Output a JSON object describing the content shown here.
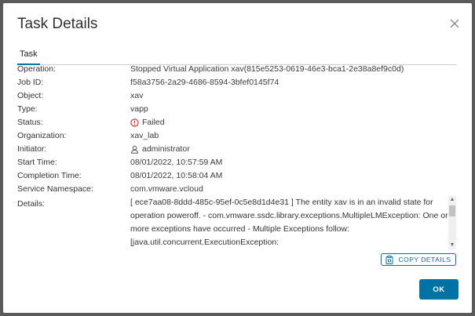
{
  "dialog": {
    "title": "Task Details",
    "tab_label": "Task"
  },
  "fields": [
    {
      "label": "Operation:",
      "value": "Stopped Virtual Application xav(815e5253-0619-46e3-bca1-2e38a8ef9c0d)"
    },
    {
      "label": "Job ID:",
      "value": "f58a3756-2a29-4686-8594-3bfef0145f74"
    },
    {
      "label": "Object:",
      "value": "xav"
    },
    {
      "label": "Type:",
      "value": "vapp"
    },
    {
      "label": "Status:",
      "value": "Failed",
      "icon": "error-circle-icon",
      "color": "#e02020"
    },
    {
      "label": "Organization:",
      "value": "xav_lab"
    },
    {
      "label": "Initiator:",
      "value": "administrator",
      "icon": "user-icon"
    },
    {
      "label": "Start Time:",
      "value": "08/01/2022, 10:57:59 AM"
    },
    {
      "label": "Completion Time:",
      "value": "08/01/2022, 10:58:04 AM"
    },
    {
      "label": "Service Namespace:",
      "value": "com.vmware.vcloud"
    }
  ],
  "details": {
    "label": "Details:",
    "text": "[ ece7aa08-8ddd-485c-95ef-0c5e8d1d4e31 ] The entity xav is in an invalid state for operation poweroff. - com.vmware.ssdc.library.exceptions.MultipleLMException: One or more exceptions have occurred - Multiple Exceptions follow: [java.util.concurrent.ExecutionException:"
  },
  "buttons": {
    "copy_details": "COPY DETAILS",
    "ok": "OK"
  },
  "colors": {
    "accent": "#0072a3",
    "error": "#e02020"
  }
}
